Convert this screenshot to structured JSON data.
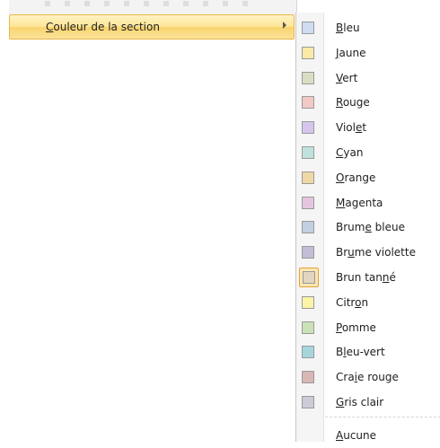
{
  "parent_menu": {
    "item_label": "Couleur de la section"
  },
  "submenu": {
    "colors": [
      {
        "label": "Bleu",
        "color": "#cfdcf2"
      },
      {
        "label": "Jaune",
        "color": "#fbe9a8"
      },
      {
        "label": "Vert",
        "color": "#d8dec1"
      },
      {
        "label": "Rouge",
        "color": "#f2c9c5"
      },
      {
        "label": "Violet",
        "color": "#d6c6ee"
      },
      {
        "label": "Cyan",
        "color": "#bfe3dc"
      },
      {
        "label": "Orange",
        "color": "#efd7a6"
      },
      {
        "label": "Magenta",
        "color": "#e6c5e0"
      },
      {
        "label": "Brume bleue",
        "color": "#c2cfe0"
      },
      {
        "label": "Brume violette",
        "color": "#c4bdd6"
      },
      {
        "label": "Brun tanné",
        "color": "#e3d6c0",
        "selected": true
      },
      {
        "label": "Citron",
        "color": "#fbf3a6"
      },
      {
        "label": "Pomme",
        "color": "#c9e3b6"
      },
      {
        "label": "Bleu-vert",
        "color": "#a6d6dc"
      },
      {
        "label": "Craie rouge",
        "color": "#d8b7b4"
      },
      {
        "label": "Gris clair",
        "color": "#cdcbd6"
      }
    ],
    "none_label": "Aucune"
  }
}
